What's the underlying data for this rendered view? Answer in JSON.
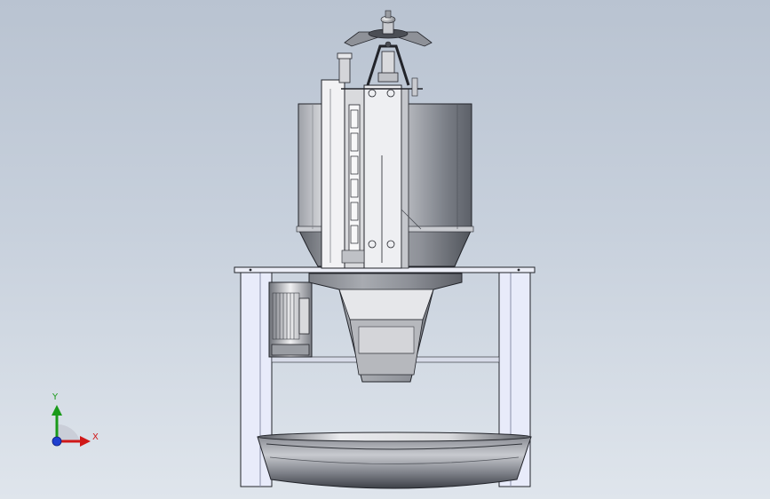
{
  "triad": {
    "y_label": "Y",
    "x_label": "X",
    "colors": {
      "x": "#d01818",
      "y": "#1a9a1a",
      "z": "#1f3fd0"
    }
  },
  "model": {
    "icons": [
      "machine-model-icon"
    ],
    "colors": {
      "background_top": "#b9c3d1",
      "background_bottom": "#dfe5ec",
      "frame": "#e8ebfa",
      "steel_dark": "#4b4e55",
      "steel_light": "#f2f2f2"
    }
  }
}
